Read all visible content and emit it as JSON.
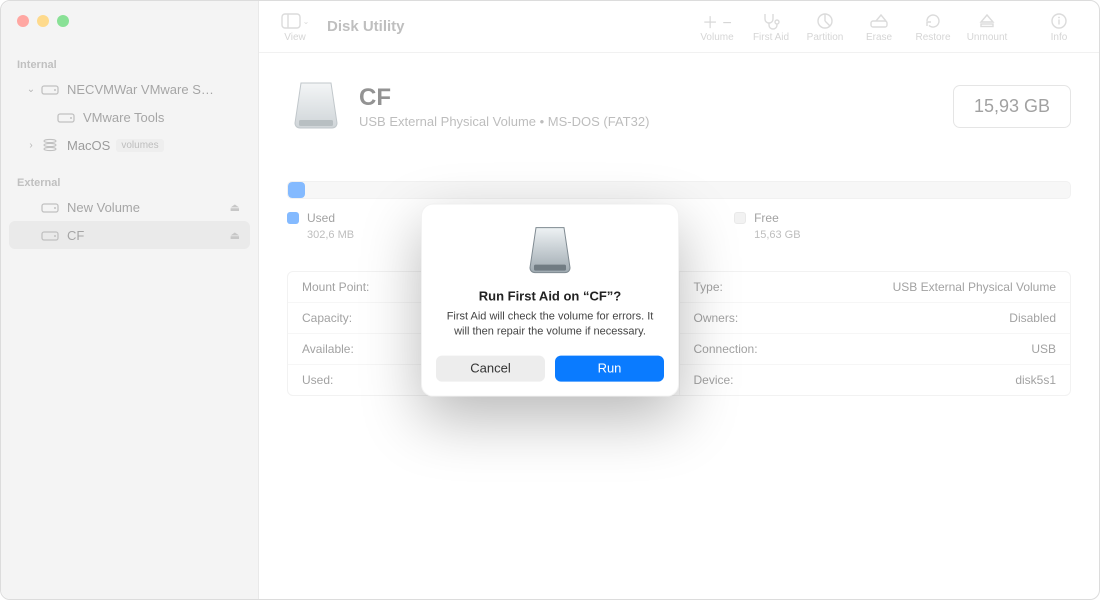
{
  "app_title": "Disk Utility",
  "toolbar": {
    "view_label": "View",
    "volume_label": "Volume",
    "first_aid_label": "First Aid",
    "partition_label": "Partition",
    "erase_label": "Erase",
    "restore_label": "Restore",
    "unmount_label": "Unmount",
    "info_label": "Info"
  },
  "sidebar": {
    "internal_label": "Internal",
    "external_label": "External",
    "internal": [
      {
        "name": "NECVMWar VMware SATA...",
        "expandable": true,
        "expanded": true
      },
      {
        "name": "VMware Tools",
        "child": true
      },
      {
        "name": "MacOS",
        "pill": "volumes",
        "expandable": true,
        "expanded": false
      }
    ],
    "external": [
      {
        "name": "New Volume",
        "ejectable": true
      },
      {
        "name": "CF",
        "ejectable": true,
        "selected": true
      }
    ]
  },
  "volume": {
    "name": "CF",
    "subtitle": "USB External Physical Volume • MS-DOS (FAT32)",
    "capacity_display": "15,93 GB",
    "used_label": "Used",
    "used_value": "302,6 MB",
    "free_label": "Free",
    "free_value": "15,63 GB"
  },
  "info": {
    "rows": [
      {
        "left_k": "Mount Point:",
        "left_v": "",
        "right_k": "Type:",
        "right_v": "USB External Physical Volume"
      },
      {
        "left_k": "Capacity:",
        "left_v": "",
        "right_k": "Owners:",
        "right_v": "Disabled"
      },
      {
        "left_k": "Available:",
        "left_v": "",
        "right_k": "Connection:",
        "right_v": "USB"
      },
      {
        "left_k": "Used:",
        "left_v": "",
        "right_k": "Device:",
        "right_v": "disk5s1"
      }
    ]
  },
  "dialog": {
    "title": "Run First Aid on “CF”?",
    "body": "First Aid will check the volume for errors. It will then repair the volume if necessary.",
    "cancel": "Cancel",
    "run": "Run"
  }
}
